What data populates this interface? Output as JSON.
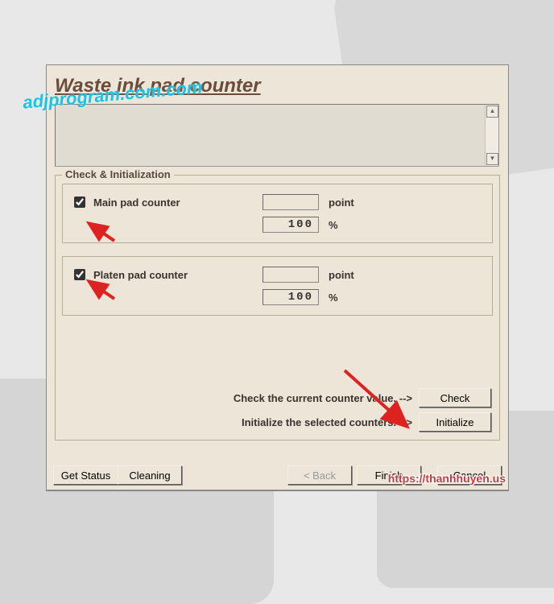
{
  "title": "Waste ink pad counter",
  "group": {
    "legend": "Check & Initialization"
  },
  "counters": {
    "main": {
      "label": "Main pad counter",
      "checked": true,
      "point_value": "",
      "point_unit": "point",
      "pct_value": "100",
      "pct_unit": "%"
    },
    "platen": {
      "label": "Platen pad counter",
      "checked": true,
      "point_value": "",
      "point_unit": "point",
      "pct_value": "100",
      "pct_unit": "%"
    }
  },
  "actions": {
    "check_text": "Check the current counter value. -->",
    "check_btn": "Check",
    "init_text": "Initialize the selected counters. -->",
    "init_btn": "Initialize"
  },
  "bottom": {
    "get_status": "Get Status",
    "cleaning": "Cleaning",
    "back": "< Back",
    "finish": "Finish",
    "cancel": "Cancel"
  },
  "watermarks": {
    "w1": "adjprogram.com.com",
    "w2": "https://thanhhuyen.us"
  }
}
